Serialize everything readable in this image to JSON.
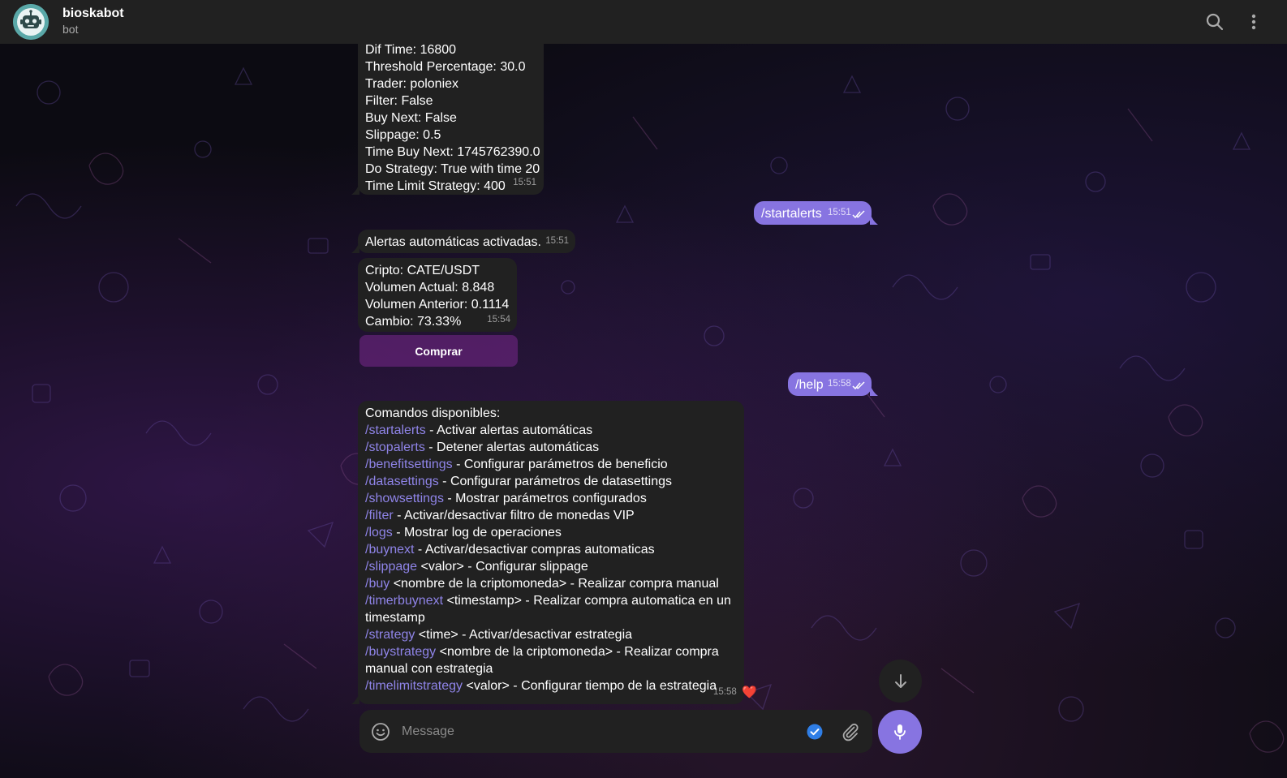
{
  "header": {
    "title": "bioskabot",
    "subtitle": "bot",
    "icons": [
      "search-icon",
      "more-vertical-icon"
    ]
  },
  "messages": {
    "settings_msg": {
      "lines": [
        "Dif Time: 16800",
        "Threshold Percentage: 30.0",
        "Trader: poloniex",
        "Filter: False",
        "Buy Next: False",
        "Slippage: 0.5",
        "Time Buy Next: 1745762390.0",
        "Do Strategy: True with time 20",
        "Time Limit Strategy: 400"
      ],
      "time": "15:51"
    },
    "startalerts_out": {
      "text": "/startalerts",
      "time": "15:51"
    },
    "alerts_on": {
      "text": "Alertas automáticas activadas.",
      "time": "15:51"
    },
    "crypto_alert": {
      "lines": [
        "Cripto: CATE/USDT",
        "Volumen Actual: 8.848",
        "Volumen Anterior: 0.1114",
        "Cambio: 73.33%"
      ],
      "time": "15:54",
      "button": "Comprar"
    },
    "help_out": {
      "text": "/help",
      "time": "15:58"
    },
    "help_reply": {
      "title": "Comandos disponibles:",
      "commands": [
        {
          "cmd": "/startalerts",
          "desc": " - Activar alertas automáticas"
        },
        {
          "cmd": "/stopalerts",
          "desc": " - Detener alertas automáticas"
        },
        {
          "cmd": "/benefitsettings",
          "desc": " - Configurar parámetros de beneficio"
        },
        {
          "cmd": "/datasettings",
          "desc": " - Configurar parámetros de datasettings"
        },
        {
          "cmd": "/showsettings",
          "desc": " - Mostrar parámetros configurados"
        },
        {
          "cmd": "/filter",
          "desc": " - Activar/desactivar filtro de monedas VIP"
        },
        {
          "cmd": "/logs",
          "desc": " - Mostrar log de operaciones"
        },
        {
          "cmd": "/buynext",
          "desc": " - Activar/desactivar compras automaticas"
        },
        {
          "cmd": "/slippage",
          "desc": " <valor> - Configurar slippage"
        },
        {
          "cmd": "/buy",
          "desc": " <nombre de la criptomoneda> - Realizar compra manual"
        },
        {
          "cmd": "/timerbuynext",
          "desc": " <timestamp> - Realizar compra automatica en un",
          "cont": "timestamp"
        },
        {
          "cmd": "/strategy",
          "desc": " <time> - Activar/desactivar estrategia"
        },
        {
          "cmd": "/buystrategy",
          "desc": " <nombre de la criptomoneda> - Realizar compra",
          "cont": "manual con estrategia"
        },
        {
          "cmd": "/timelimitstrategy",
          "desc": " <valor> - Configurar tiempo de la estrategia"
        }
      ],
      "time": "15:58",
      "reaction": "❤️"
    }
  },
  "composer": {
    "placeholder": "Message",
    "icons": [
      "emoji-icon",
      "verified-check-icon",
      "attach-icon",
      "microphone-icon"
    ]
  },
  "scroll_down": {
    "icon": "arrow-down-icon"
  },
  "colors": {
    "header_bg": "#212121",
    "incoming_bubble": "#212121",
    "outgoing_bubble": "#8774e1",
    "command_link": "#8f84e8",
    "accent": "#8774e1"
  }
}
